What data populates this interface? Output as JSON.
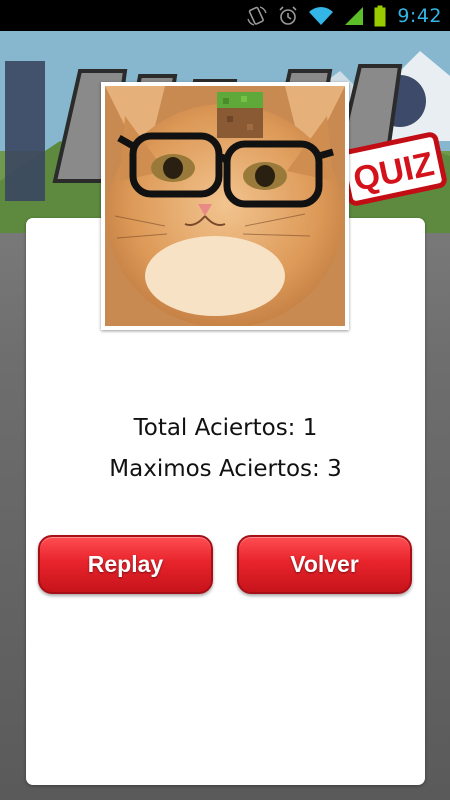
{
  "status_bar": {
    "time": "9:42",
    "icons": [
      "screen-rotate-icon",
      "alarm-icon",
      "wifi-icon",
      "signal-icon",
      "battery-icon"
    ],
    "clock_color": "#33b5e5"
  },
  "banner": {
    "quiz_label": "QUIZ",
    "description": "game-title-banner"
  },
  "result": {
    "photo": "cat-with-glasses-and-grass-block",
    "total_hits": "Total Aciertos: 1",
    "max_hits": "Maximos Aciertos: 3"
  },
  "buttons": {
    "replay_label": "Replay",
    "back_label": "Volver",
    "color": "#e8242c"
  }
}
